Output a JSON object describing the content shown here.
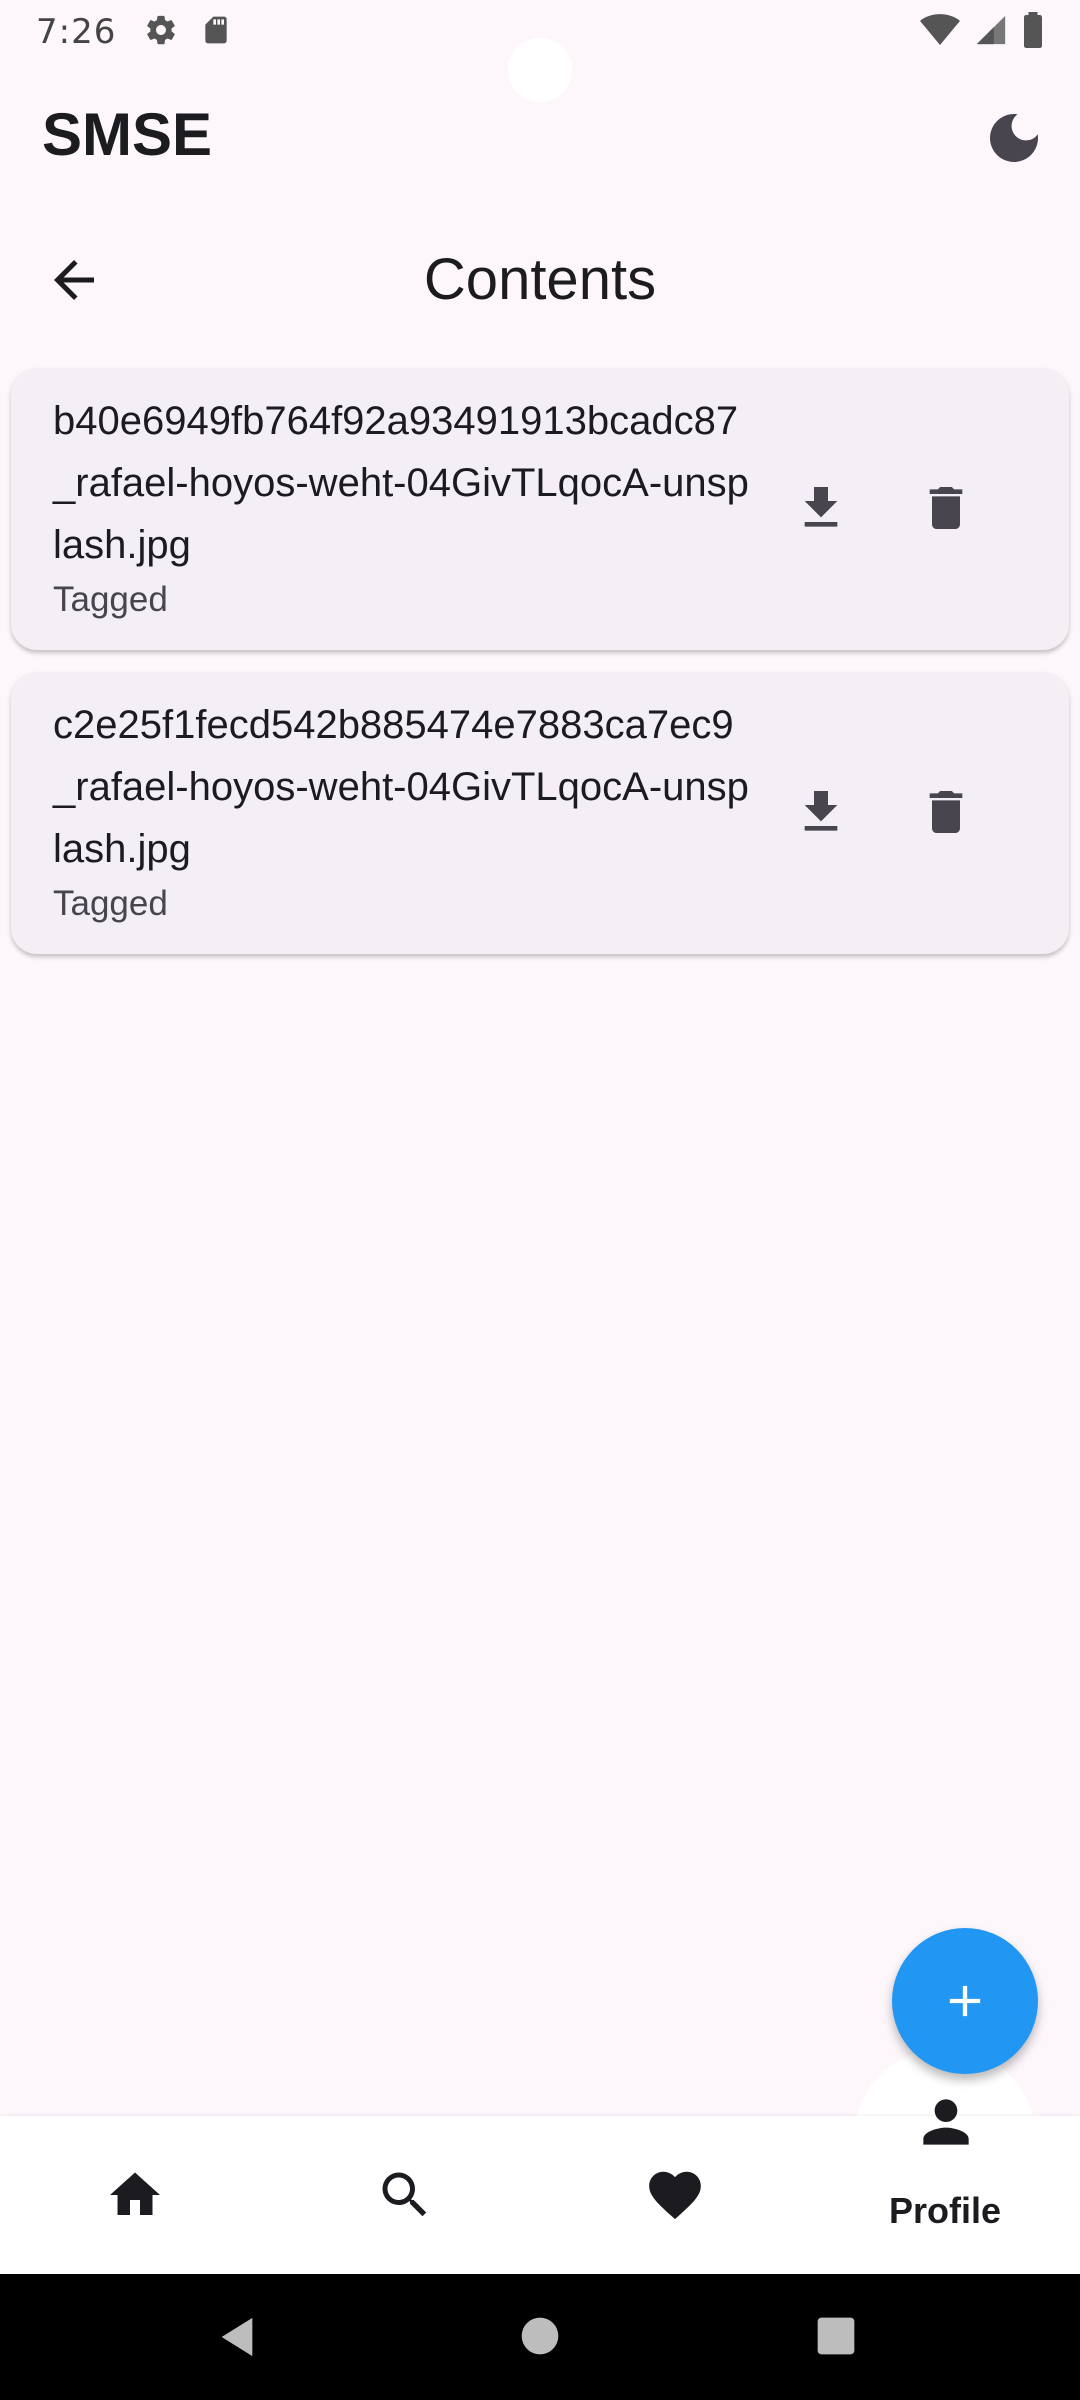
{
  "status_bar": {
    "time": "7:26",
    "icons": [
      "settings-icon",
      "sd-card-icon",
      "wifi-icon",
      "signal-icon",
      "battery-icon"
    ]
  },
  "app_bar": {
    "title": "SMSE",
    "theme_icon": "dark-mode-moon-icon"
  },
  "page": {
    "title": "Contents",
    "back_icon": "arrow-back-icon"
  },
  "contents": [
    {
      "filename": "b40e6949fb764f92a93491913bcadc87_rafael-hoyos-weht-04GivTLqocA-unsplash.jpg",
      "status": "Tagged"
    },
    {
      "filename": "c2e25f1fecd542b885474e7883ca7ec9_rafael-hoyos-weht-04GivTLqocA-unsplash.jpg",
      "status": "Tagged"
    }
  ],
  "fab": {
    "icon": "plus-icon"
  },
  "bottom_nav": {
    "items": [
      {
        "icon": "home-icon"
      },
      {
        "icon": "search-icon"
      },
      {
        "icon": "heart-icon"
      },
      {
        "icon": "person-icon",
        "label": "Profile",
        "selected": true
      }
    ]
  },
  "colors": {
    "background": "#fdf7fc",
    "card": "#f3eff5",
    "fab": "#2196f3",
    "icon": "#49454f"
  }
}
